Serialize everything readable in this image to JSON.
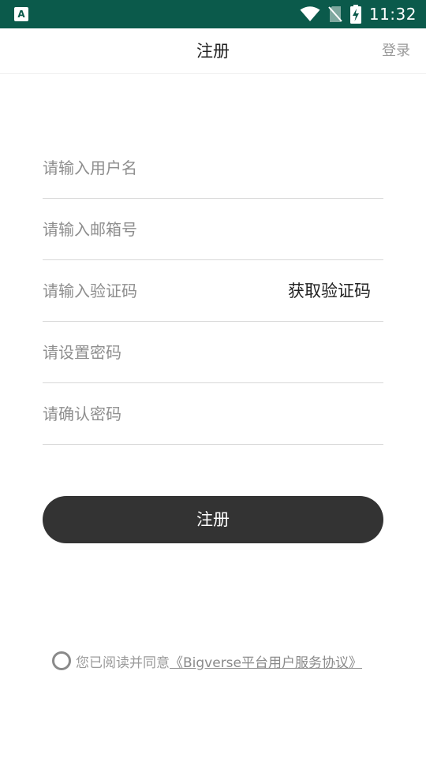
{
  "status_bar": {
    "time": "11:32",
    "app_icon_letter": "A",
    "icons": [
      "wifi-icon",
      "no-sim-icon",
      "battery-charging-icon"
    ],
    "background_color": "#0b5a4b"
  },
  "header": {
    "title": "注册",
    "login_label": "登录"
  },
  "form": {
    "username_placeholder": "请输入用户名",
    "email_placeholder": "请输入邮箱号",
    "code_placeholder": "请输入验证码",
    "get_code_label": "获取验证码",
    "password_placeholder": "请设置密码",
    "confirm_password_placeholder": "请确认密码",
    "submit_label": "注册"
  },
  "agreement": {
    "prefix": "您已阅读并同意",
    "link": "《Bigverse平台用户服务协议》",
    "checked": false
  }
}
